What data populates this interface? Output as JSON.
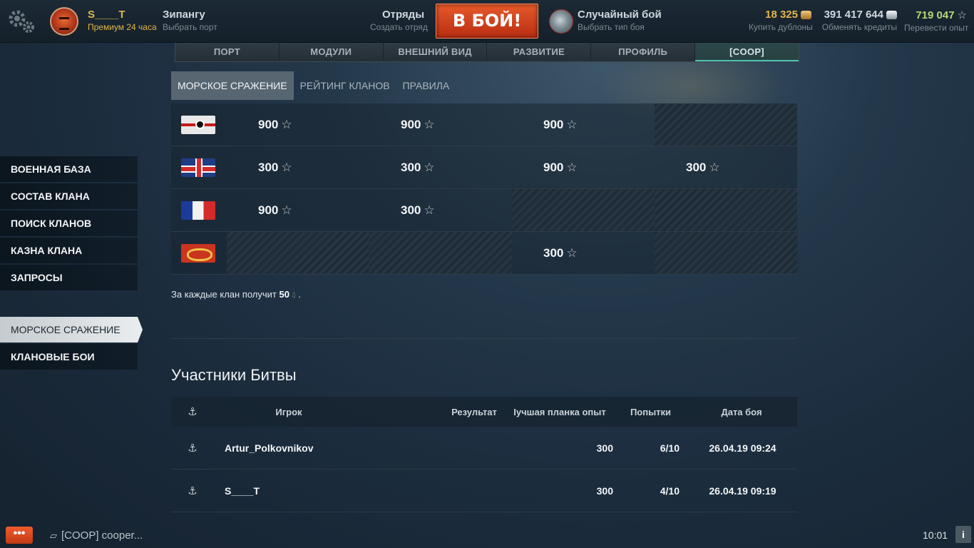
{
  "topbar": {
    "player_name": "S____T",
    "premium": "Премиум 24 часа",
    "port_name": "Зипангу",
    "port_sub": "Выбрать порт",
    "squads": "Отряды",
    "squads_sub": "Создать отряд",
    "battle_button": "В БОЙ!",
    "mode": "Случайный бой",
    "mode_sub": "Выбрать тип боя",
    "doubloons": "18 325",
    "doubloons_sub": "Купить дублоны",
    "credits": "391 417 644",
    "credits_sub": "Обменять кредиты",
    "exp": "719 047",
    "exp_sub": "Перевести опыт",
    "colors": {
      "accent": "#e2b54a",
      "battle": "#d6451f",
      "exp": "#b5d877"
    }
  },
  "tabs": [
    "ПОРТ",
    "МОДУЛИ",
    "ВНЕШНИЙ ВИД",
    "РАЗВИТИЕ",
    "ПРОФИЛЬ",
    "[COOP]"
  ],
  "active_tab": 5,
  "subtabs": [
    "МОРСКОЕ СРАЖЕНИЕ",
    "РЕЙТИНГ КЛАНОВ",
    "ПРАВИЛА"
  ],
  "sidebar": {
    "group1": [
      "ВОЕННАЯ БАЗА",
      "СОСТАВ КЛАНА",
      "ПОИСК КЛАНОВ",
      "КАЗНА КЛАНА",
      "ЗАПРОСЫ"
    ],
    "group2": [
      "МОРСКОЕ СРАЖЕНИЕ",
      "КЛАНОВЫЕ БОИ"
    ]
  },
  "rewards": {
    "star": "☆",
    "rows": [
      {
        "flag": "flag-germany",
        "values": [
          "900",
          "900",
          "900",
          ""
        ]
      },
      {
        "flag": "flag-uk",
        "values": [
          "300",
          "300",
          "900",
          "300"
        ]
      },
      {
        "flag": "flag-france",
        "values": [
          "900",
          "300",
          "",
          ""
        ]
      },
      {
        "flag": "flag-pan-asia",
        "values": [
          "",
          "",
          "300",
          ""
        ]
      }
    ]
  },
  "note": {
    "text": "За каждые клан получит",
    "amount": "50",
    "suffix": "."
  },
  "participants": {
    "title": "Участники Битвы",
    "headers": {
      "player": "Игрок",
      "result": "Результат",
      "best": "Іучшая планка опыт",
      "tries": "Попытки",
      "date": "Дата боя"
    },
    "rows": [
      {
        "player": "Artur_Polkovnikov",
        "result": "",
        "best": "300",
        "tries": "6/10",
        "date": "26.04.19 09:24"
      },
      {
        "player": "S____T",
        "result": "",
        "best": "300",
        "tries": "4/10",
        "date": "26.04.19 09:19"
      }
    ]
  },
  "bottom": {
    "chat_button": "•••",
    "chat_text": "[COOP] cooper...",
    "clock": "10:01",
    "info": "i"
  }
}
